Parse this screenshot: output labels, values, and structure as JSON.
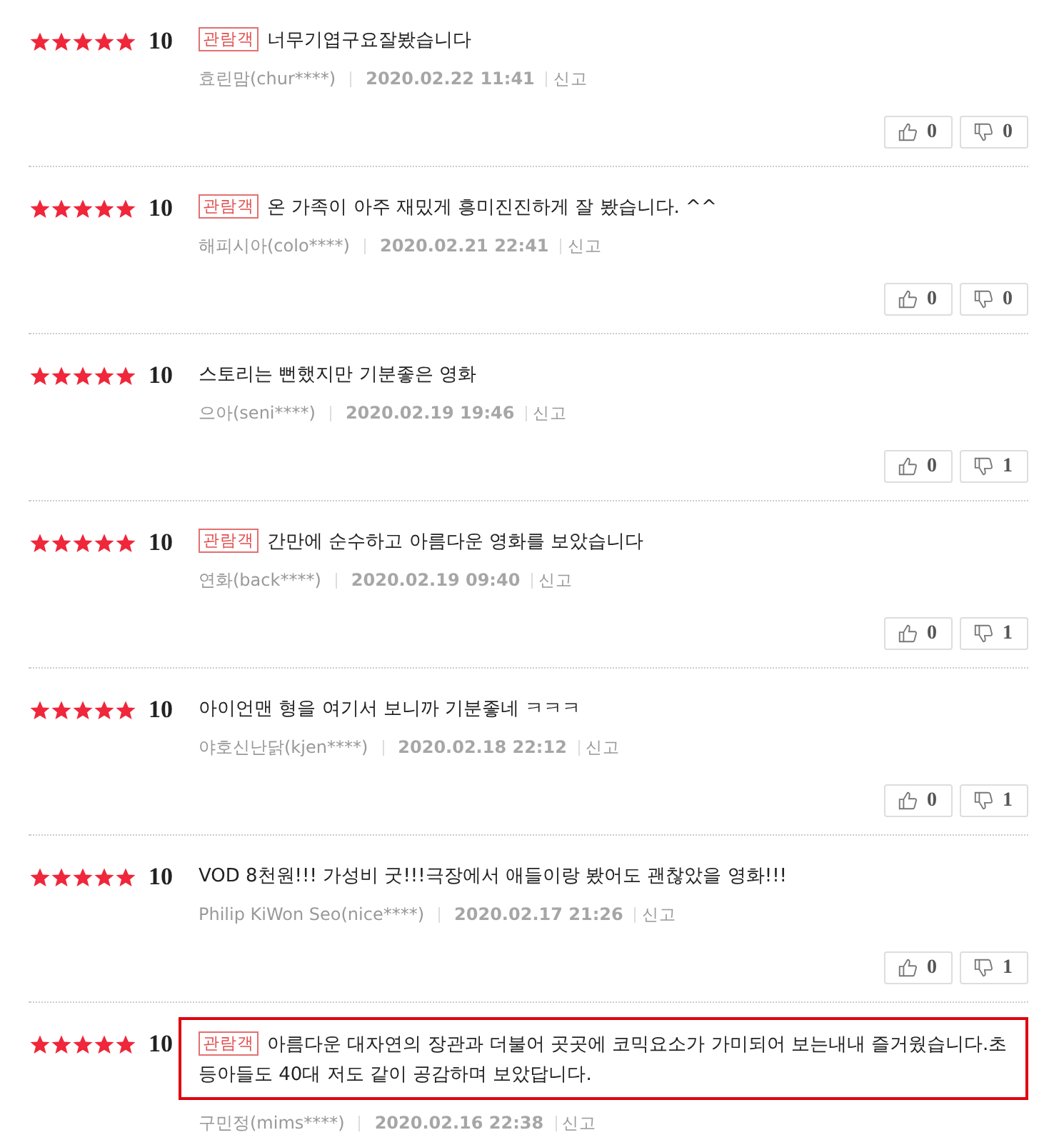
{
  "reviews": [
    {
      "stars": 5,
      "score": "10",
      "badge": "관람객",
      "text": "너무기엽구요잘봤습니다",
      "author": "효린맘(chur****)",
      "date": "2020.02.22 11:41",
      "report": "신고",
      "likes": "0",
      "dislikes": "0",
      "highlighted": false
    },
    {
      "stars": 5,
      "score": "10",
      "badge": "관람객",
      "text": "온 가족이 아주 재밌게 흥미진진하게 잘 봤습니다. ^^",
      "author": "해피시아(colo****)",
      "date": "2020.02.21 22:41",
      "report": "신고",
      "likes": "0",
      "dislikes": "0",
      "highlighted": false
    },
    {
      "stars": 5,
      "score": "10",
      "text": "스토리는 뻔했지만 기분좋은 영화",
      "author": "으아(seni****)",
      "date": "2020.02.19 19:46",
      "report": "신고",
      "likes": "0",
      "dislikes": "1",
      "highlighted": false
    },
    {
      "stars": 5,
      "score": "10",
      "badge": "관람객",
      "text": "간만에 순수하고 아름다운 영화를 보았습니다",
      "author": "연화(back****)",
      "date": "2020.02.19 09:40",
      "report": "신고",
      "likes": "0",
      "dislikes": "1",
      "highlighted": false
    },
    {
      "stars": 5,
      "score": "10",
      "text": "아이언맨 형을 여기서 보니까 기분좋네 ㅋㅋㅋ",
      "author": "야호신난닭(kjen****)",
      "date": "2020.02.18 22:12",
      "report": "신고",
      "likes": "0",
      "dislikes": "1",
      "highlighted": false
    },
    {
      "stars": 5,
      "score": "10",
      "text": "VOD 8천원!!! 가성비 굿!!!극장에서 애들이랑 봤어도 괜찮았을 영화!!!",
      "author": "Philip KiWon Seo(nice****)",
      "date": "2020.02.17 21:26",
      "report": "신고",
      "likes": "0",
      "dislikes": "1",
      "highlighted": false
    },
    {
      "stars": 5,
      "score": "10",
      "badge": "관람객",
      "text": "아름다운 대자연의 장관과 더불어 곳곳에 코믹요소가 가미되어 보는내내 즐거웠습니다.초등아들도 40대 저도 같이 공감하며 보았답니다.",
      "author": "구민정(mims****)",
      "date": "2020.02.16 22:38",
      "report": "신고",
      "highlighted": true
    }
  ]
}
